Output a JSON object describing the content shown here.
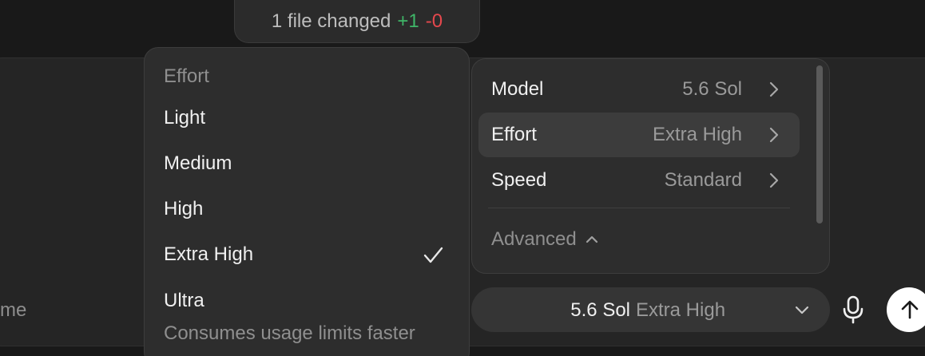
{
  "changes": {
    "summary": "1 file changed",
    "additions": "+1",
    "deletions": "-0"
  },
  "composer": {
    "placeholder_fragment": "me"
  },
  "effort_menu": {
    "header": "Effort",
    "items": [
      {
        "label": "Light",
        "selected": false
      },
      {
        "label": "Medium",
        "selected": false
      },
      {
        "label": "High",
        "selected": false
      },
      {
        "label": "Extra High",
        "selected": true
      },
      {
        "label": "Ultra",
        "selected": false,
        "description": "Consumes usage limits faster"
      }
    ],
    "check_icon": "checkmark-icon"
  },
  "settings": {
    "rows": [
      {
        "name": "Model",
        "value": "5.6 Sol",
        "active": false
      },
      {
        "name": "Effort",
        "value": "Extra High",
        "active": true
      },
      {
        "name": "Speed",
        "value": "Standard",
        "active": false
      }
    ],
    "advanced_label": "Advanced",
    "advanced_icon": "chevron-up-icon"
  },
  "model_selector": {
    "model": "5.6 Sol",
    "effort": "Extra High",
    "icon": "chevron-down-icon"
  },
  "actions": {
    "mic_icon": "microphone-icon",
    "send_icon": "arrow-up-icon"
  },
  "colors": {
    "additions": "#3fb668",
    "deletions": "#e5484d",
    "panel": "#2d2d2d",
    "active_row": "#3c3c3c",
    "send_button": "#ffffff"
  }
}
